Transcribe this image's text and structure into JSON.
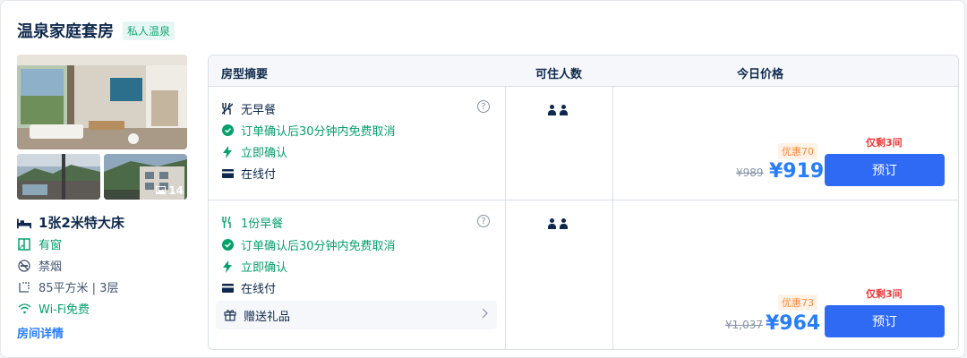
{
  "room": {
    "title": "温泉家庭套房",
    "tag": "私人温泉",
    "photo_count": "14",
    "features": {
      "bed": "1张2米特大床",
      "window": "有窗",
      "smoking": "禁烟",
      "area": "85平方米 | 3层",
      "wifi": "Wi-Fi免费"
    },
    "detail_link": "房间详情"
  },
  "table": {
    "headers": {
      "summary": "房型摘要",
      "occupancy": "可住人数",
      "price": "今日价格"
    },
    "plans": [
      {
        "meal": "无早餐",
        "cancel": "订单确认后30分钟内免费取消",
        "confirm": "立即确认",
        "pay": "在线付",
        "help": "?",
        "left": "仅剩3间",
        "discount": "优惠70",
        "orig_price": "¥989",
        "price": "¥919",
        "book": "预订"
      },
      {
        "meal": "1份早餐",
        "cancel": "订单确认后30分钟内免费取消",
        "confirm": "立即确认",
        "pay": "在线付",
        "help": "?",
        "gift": "赠送礼品",
        "left": "仅剩3间",
        "discount": "优惠73",
        "orig_price": "¥1,037",
        "price": "¥964",
        "book": "预订"
      }
    ]
  },
  "colors": {
    "accent": "#287dfa",
    "button": "#2f6af5",
    "green": "#06a06b",
    "red": "#eb3a3a",
    "orange": "#ff8a3c"
  }
}
